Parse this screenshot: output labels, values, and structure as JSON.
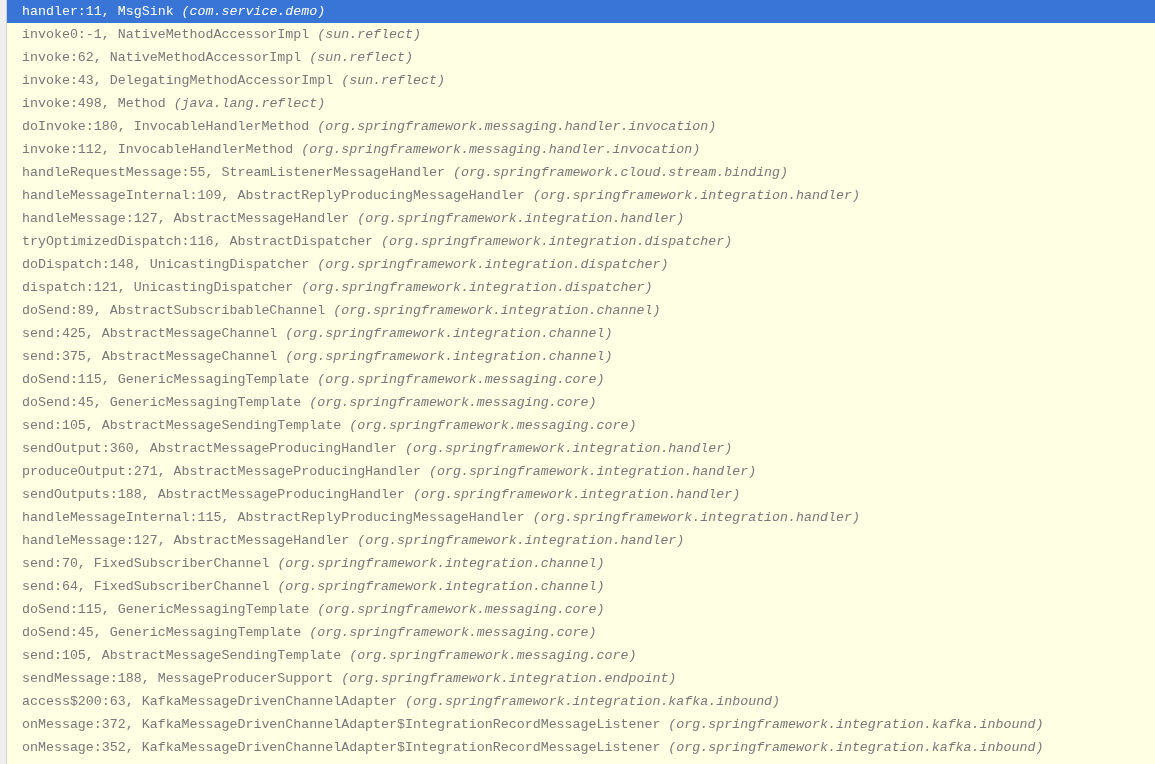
{
  "frames": [
    {
      "location": "handler:11, MsgSink",
      "package": "(com.service.demo)",
      "selected": true
    },
    {
      "location": "invoke0:-1, NativeMethodAccessorImpl",
      "package": "(sun.reflect)",
      "selected": false
    },
    {
      "location": "invoke:62, NativeMethodAccessorImpl",
      "package": "(sun.reflect)",
      "selected": false
    },
    {
      "location": "invoke:43, DelegatingMethodAccessorImpl",
      "package": "(sun.reflect)",
      "selected": false
    },
    {
      "location": "invoke:498, Method",
      "package": "(java.lang.reflect)",
      "selected": false
    },
    {
      "location": "doInvoke:180, InvocableHandlerMethod",
      "package": "(org.springframework.messaging.handler.invocation)",
      "selected": false
    },
    {
      "location": "invoke:112, InvocableHandlerMethod",
      "package": "(org.springframework.messaging.handler.invocation)",
      "selected": false
    },
    {
      "location": "handleRequestMessage:55, StreamListenerMessageHandler",
      "package": "(org.springframework.cloud.stream.binding)",
      "selected": false
    },
    {
      "location": "handleMessageInternal:109, AbstractReplyProducingMessageHandler",
      "package": "(org.springframework.integration.handler)",
      "selected": false
    },
    {
      "location": "handleMessage:127, AbstractMessageHandler",
      "package": "(org.springframework.integration.handler)",
      "selected": false
    },
    {
      "location": "tryOptimizedDispatch:116, AbstractDispatcher",
      "package": "(org.springframework.integration.dispatcher)",
      "selected": false
    },
    {
      "location": "doDispatch:148, UnicastingDispatcher",
      "package": "(org.springframework.integration.dispatcher)",
      "selected": false
    },
    {
      "location": "dispatch:121, UnicastingDispatcher",
      "package": "(org.springframework.integration.dispatcher)",
      "selected": false
    },
    {
      "location": "doSend:89, AbstractSubscribableChannel",
      "package": "(org.springframework.integration.channel)",
      "selected": false
    },
    {
      "location": "send:425, AbstractMessageChannel",
      "package": "(org.springframework.integration.channel)",
      "selected": false
    },
    {
      "location": "send:375, AbstractMessageChannel",
      "package": "(org.springframework.integration.channel)",
      "selected": false
    },
    {
      "location": "doSend:115, GenericMessagingTemplate",
      "package": "(org.springframework.messaging.core)",
      "selected": false
    },
    {
      "location": "doSend:45, GenericMessagingTemplate",
      "package": "(org.springframework.messaging.core)",
      "selected": false
    },
    {
      "location": "send:105, AbstractMessageSendingTemplate",
      "package": "(org.springframework.messaging.core)",
      "selected": false
    },
    {
      "location": "sendOutput:360, AbstractMessageProducingHandler",
      "package": "(org.springframework.integration.handler)",
      "selected": false
    },
    {
      "location": "produceOutput:271, AbstractMessageProducingHandler",
      "package": "(org.springframework.integration.handler)",
      "selected": false
    },
    {
      "location": "sendOutputs:188, AbstractMessageProducingHandler",
      "package": "(org.springframework.integration.handler)",
      "selected": false
    },
    {
      "location": "handleMessageInternal:115, AbstractReplyProducingMessageHandler",
      "package": "(org.springframework.integration.handler)",
      "selected": false
    },
    {
      "location": "handleMessage:127, AbstractMessageHandler",
      "package": "(org.springframework.integration.handler)",
      "selected": false
    },
    {
      "location": "send:70, FixedSubscriberChannel",
      "package": "(org.springframework.integration.channel)",
      "selected": false
    },
    {
      "location": "send:64, FixedSubscriberChannel",
      "package": "(org.springframework.integration.channel)",
      "selected": false
    },
    {
      "location": "doSend:115, GenericMessagingTemplate",
      "package": "(org.springframework.messaging.core)",
      "selected": false
    },
    {
      "location": "doSend:45, GenericMessagingTemplate",
      "package": "(org.springframework.messaging.core)",
      "selected": false
    },
    {
      "location": "send:105, AbstractMessageSendingTemplate",
      "package": "(org.springframework.messaging.core)",
      "selected": false
    },
    {
      "location": "sendMessage:188, MessageProducerSupport",
      "package": "(org.springframework.integration.endpoint)",
      "selected": false
    },
    {
      "location": "access$200:63, KafkaMessageDrivenChannelAdapter",
      "package": "(org.springframework.integration.kafka.inbound)",
      "selected": false
    },
    {
      "location": "onMessage:372, KafkaMessageDrivenChannelAdapter$IntegrationRecordMessageListener",
      "package": "(org.springframework.integration.kafka.inbound)",
      "selected": false
    },
    {
      "location": "onMessage:352, KafkaMessageDrivenChannelAdapter$IntegrationRecordMessageListener",
      "package": "(org.springframework.integration.kafka.inbound)",
      "selected": false
    }
  ]
}
